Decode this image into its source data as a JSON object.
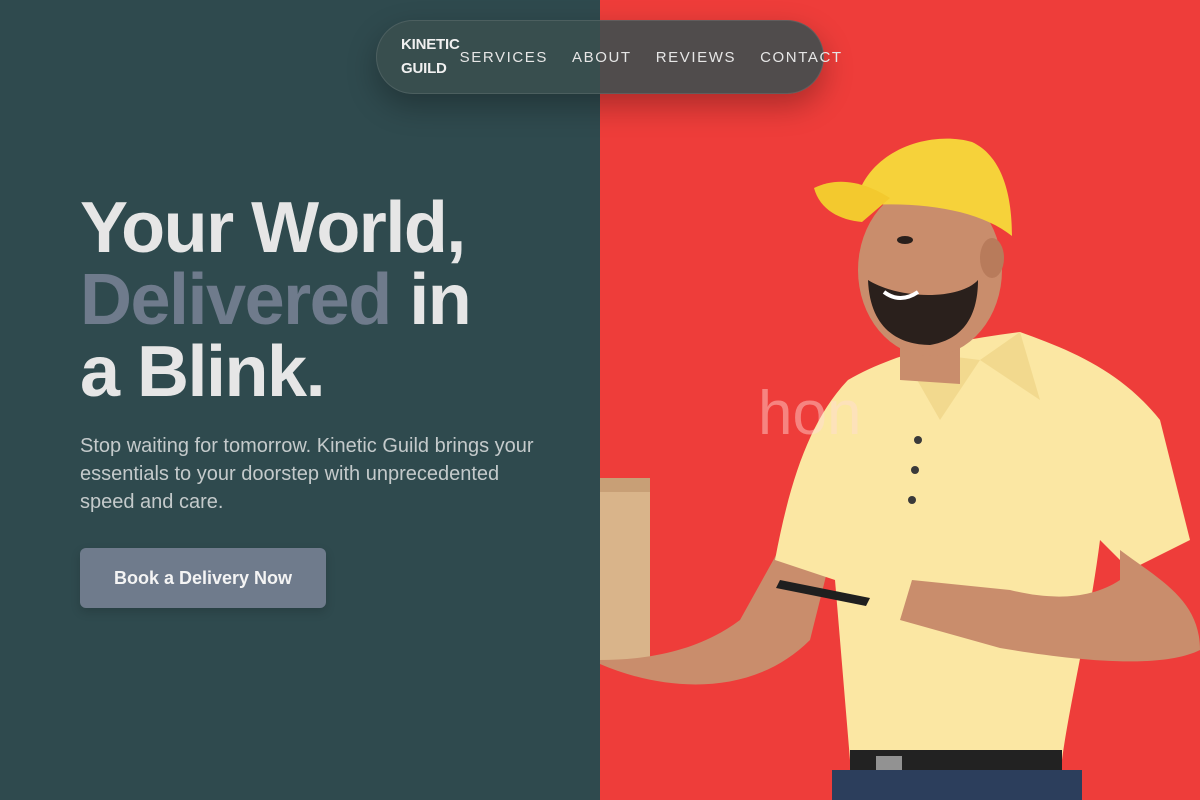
{
  "brand": {
    "line1": "KINETIC",
    "line2": "GUILD"
  },
  "nav": {
    "links": [
      "SERVICES",
      "ABOUT",
      "REVIEWS",
      "CONTACT"
    ]
  },
  "hero": {
    "title_line1": "Your World,",
    "title_accent": "Delivered",
    "title_line2_rest": " in",
    "title_line3": "a Blink.",
    "subtitle": "Stop waiting for tomorrow. Kinetic Guild brings your essentials to your doorstep with unprecedented speed and care.",
    "cta_label": "Book a Delivery Now"
  },
  "image": {
    "description_icon": "delivery-person-photo",
    "watermark_text": "hon"
  },
  "colors": {
    "left_bg": "#2f4a4e",
    "right_bg": "#ee3d3a",
    "accent": "#6f7b8c",
    "text_light": "#e6e6e6"
  }
}
